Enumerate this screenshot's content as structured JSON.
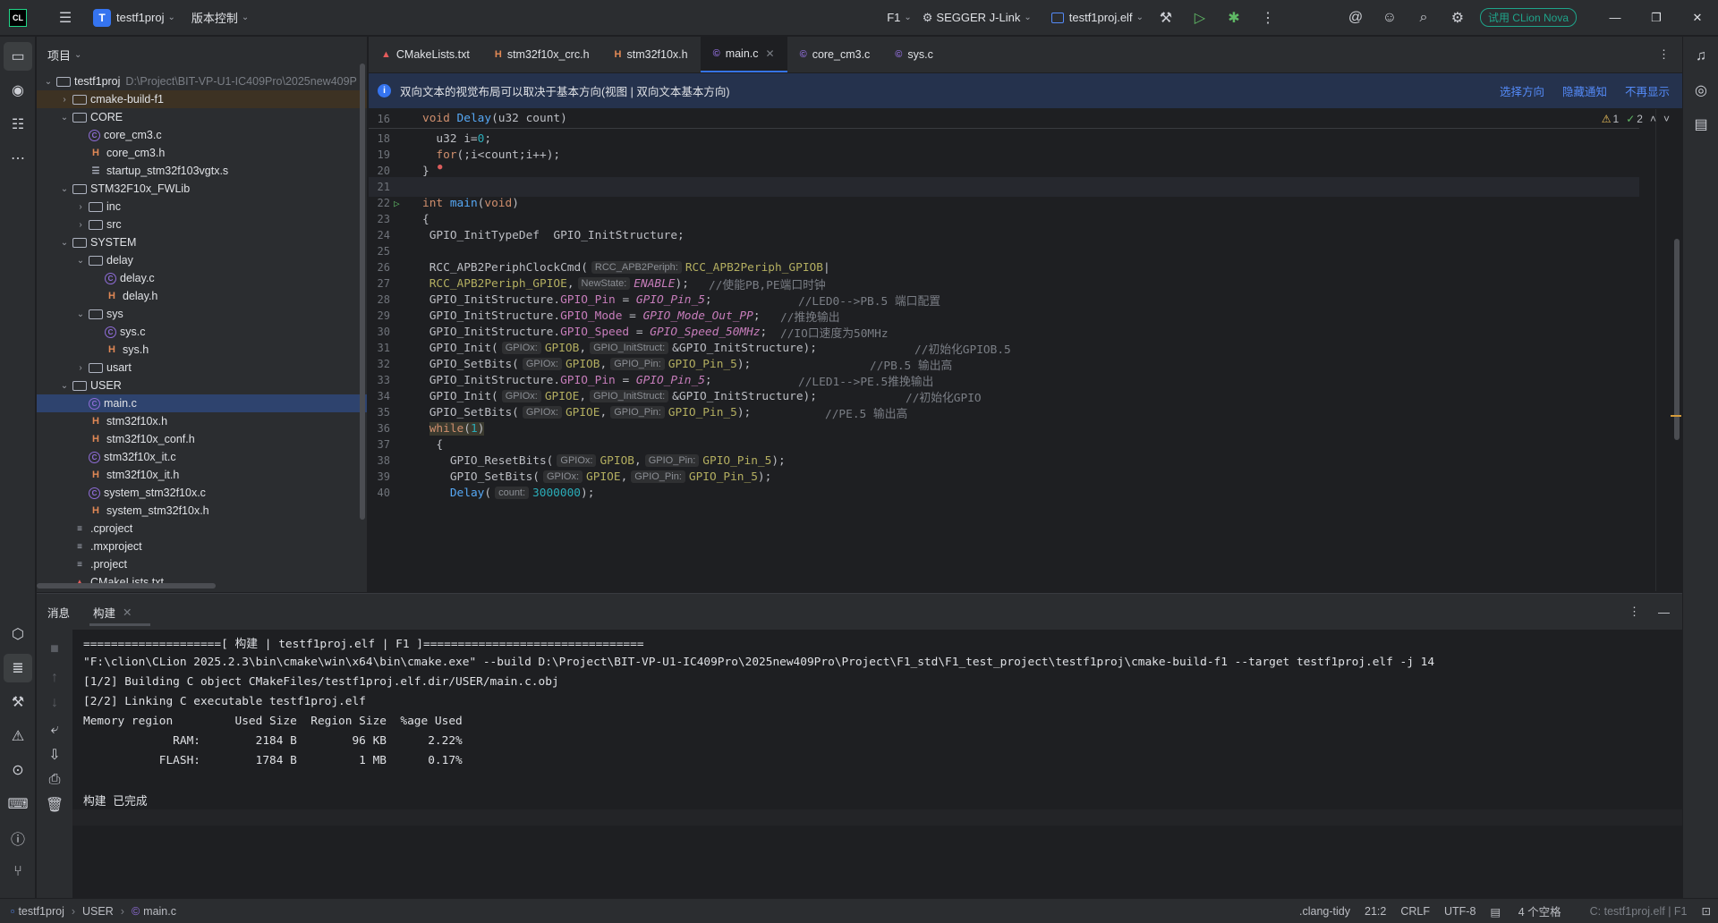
{
  "titlebar": {
    "app_logo": "CL",
    "project_badge": "T",
    "project_name": "testf1proj",
    "vcs_label": "版本控制",
    "config": "F1",
    "debugger": "SEGGER J-Link",
    "target": "testf1proj.elf",
    "trial_label": "试用 CLion Nova"
  },
  "project_panel": {
    "title": "项目",
    "items": [
      {
        "name": "testf1proj",
        "path": "D:\\Project\\BIT-VP-U1-IC409Pro\\2025new409P"
      },
      {
        "name": "cmake-build-f1"
      },
      {
        "name": "CORE"
      },
      {
        "name": "core_cm3.c"
      },
      {
        "name": "core_cm3.h"
      },
      {
        "name": "startup_stm32f103vgtx.s"
      },
      {
        "name": "STM32F10x_FWLib"
      },
      {
        "name": "inc"
      },
      {
        "name": "src"
      },
      {
        "name": "SYSTEM"
      },
      {
        "name": "delay"
      },
      {
        "name": "delay.c"
      },
      {
        "name": "delay.h"
      },
      {
        "name": "sys"
      },
      {
        "name": "sys.c"
      },
      {
        "name": "sys.h"
      },
      {
        "name": "usart"
      },
      {
        "name": "USER"
      },
      {
        "name": "main.c"
      },
      {
        "name": "stm32f10x.h"
      },
      {
        "name": "stm32f10x_conf.h"
      },
      {
        "name": "stm32f10x_it.c"
      },
      {
        "name": "stm32f10x_it.h"
      },
      {
        "name": "system_stm32f10x.c"
      },
      {
        "name": "system_stm32f10x.h"
      },
      {
        "name": ".cproject"
      },
      {
        "name": ".mxproject"
      },
      {
        "name": ".project"
      },
      {
        "name": "CMakeLists.txt"
      }
    ]
  },
  "tabs": [
    "CMakeLists.txt",
    "stm32f10x_crc.h",
    "stm32f10x.h",
    "main.c",
    "core_cm3.c",
    "sys.c"
  ],
  "banner": {
    "text": "双向文本的视觉布局可以取决于基本方向(视图 | 双向文本基本方向)",
    "action1": "选择方向",
    "action2": "隐藏通知",
    "action3": "不再显示"
  },
  "inspections": {
    "warnings": "1",
    "ok": "2"
  },
  "code": {
    "sticky": {
      "ln": "16",
      "text": "void Delay(u32 count)"
    },
    "lines": [
      {
        "ln": "18",
        "t1": "  u32 i=0;"
      },
      {
        "ln": "19",
        "t1": "  for(;i<count;i++);"
      },
      {
        "ln": "20",
        "t1": "}"
      },
      {
        "ln": "21",
        "t1": ""
      },
      {
        "ln": "22",
        "t1": "int main(void)"
      },
      {
        "ln": "23",
        "t1": "{"
      },
      {
        "ln": "24",
        "t1": " GPIO_InitTypeDef  GPIO_InitStructure;"
      },
      {
        "ln": "25",
        "t1": ""
      },
      {
        "ln": "26",
        "t1": " RCC_APB2PeriphClockCmd(",
        "h1": "RCC_APB2Periph:",
        "a1": "RCC_APB2Periph_GPIOB|"
      },
      {
        "ln": "27",
        "t1": " RCC_APB2Periph_GPIOE,",
        "h1": "NewState:",
        "a1": "ENABLE);",
        "c": "//使能PB,PE端口时钟"
      },
      {
        "ln": "28",
        "t1": " GPIO_InitStructure.GPIO_Pin = GPIO_Pin_5;",
        "c": "//LED0-->PB.5 端口配置"
      },
      {
        "ln": "29",
        "t1": " GPIO_InitStructure.GPIO_Mode = GPIO_Mode_Out_PP;",
        "c": "//推挽输出"
      },
      {
        "ln": "30",
        "t1": " GPIO_InitStructure.GPIO_Speed = GPIO_Speed_50MHz;",
        "c": "//IO口速度为50MHz"
      },
      {
        "ln": "31",
        "t1": " GPIO_Init(",
        "h1": "GPIOx:",
        "a1": "GPIOB,",
        "h2": "GPIO_InitStruct:",
        "a2": "&GPIO_InitStructure);",
        "c": "//初始化GPIOB.5"
      },
      {
        "ln": "32",
        "t1": " GPIO_SetBits(",
        "h1": "GPIOx:",
        "a1": "GPIOB,",
        "h2": "GPIO_Pin:",
        "a2": "GPIO_Pin_5);",
        "c": "//PB.5 输出高"
      },
      {
        "ln": "33",
        "t1": " GPIO_InitStructure.GPIO_Pin = GPIO_Pin_5;",
        "c": "//LED1-->PE.5推挽输出"
      },
      {
        "ln": "34",
        "t1": " GPIO_Init(",
        "h1": "GPIOx:",
        "a1": "GPIOE,",
        "h2": "GPIO_InitStruct:",
        "a2": "&GPIO_InitStructure);",
        "c": "//初始化GPIO"
      },
      {
        "ln": "35",
        "t1": " GPIO_SetBits(",
        "h1": "GPIOx:",
        "a1": "GPIOE,",
        "h2": "GPIO_Pin:",
        "a2": "GPIO_Pin_5);",
        "c": "//PE.5 输出高"
      },
      {
        "ln": "36",
        "t1": " while(1)"
      },
      {
        "ln": "37",
        "t1": "  {"
      },
      {
        "ln": "38",
        "t1": "    GPIO_ResetBits(",
        "h1": "GPIOx:",
        "a1": "GPIOB,",
        "h2": "GPIO_Pin:",
        "a2": "GPIO_Pin_5);"
      },
      {
        "ln": "39",
        "t1": "    GPIO_SetBits(",
        "h1": "GPIOx:",
        "a1": "GPIOE,",
        "h2": "GPIO_Pin:",
        "a2": "GPIO_Pin_5);"
      },
      {
        "ln": "40",
        "t1": "    Delay(",
        "h1": "count:",
        "a1": "3000000);"
      }
    ]
  },
  "bottom": {
    "tab1": "消息",
    "tab2": "构建",
    "output": [
      "====================[ 构建 | testf1proj.elf | F1 ]================================",
      "\"F:\\clion\\CLion 2025.2.3\\bin\\cmake\\win\\x64\\bin\\cmake.exe\" --build D:\\Project\\BIT-VP-U1-IC409Pro\\2025new409Pro\\Project\\F1_std\\F1_test_project\\testf1proj\\cmake-build-f1 --target testf1proj.elf -j 14",
      "[1/2] Building C object CMakeFiles/testf1proj.elf.dir/USER/main.c.obj",
      "[2/2] Linking C executable testf1proj.elf",
      "Memory region         Used Size  Region Size  %age Used",
      "             RAM:        2184 B        96 KB      2.22%",
      "           FLASH:        1784 B         1 MB      0.17%",
      "",
      "构建 已完成"
    ]
  },
  "status": {
    "crumb1": "testf1proj",
    "crumb2": "USER",
    "crumb3": "main.c",
    "linter": ".clang-tidy",
    "position": "21:2",
    "line_sep": "CRLF",
    "encoding": "UTF-8",
    "indent": "4 个空格",
    "context": "C: testf1proj.elf | F1"
  },
  "colors": {
    "accent": "#3574f0",
    "bg": "#1e1f22",
    "panel": "#2b2d30"
  }
}
